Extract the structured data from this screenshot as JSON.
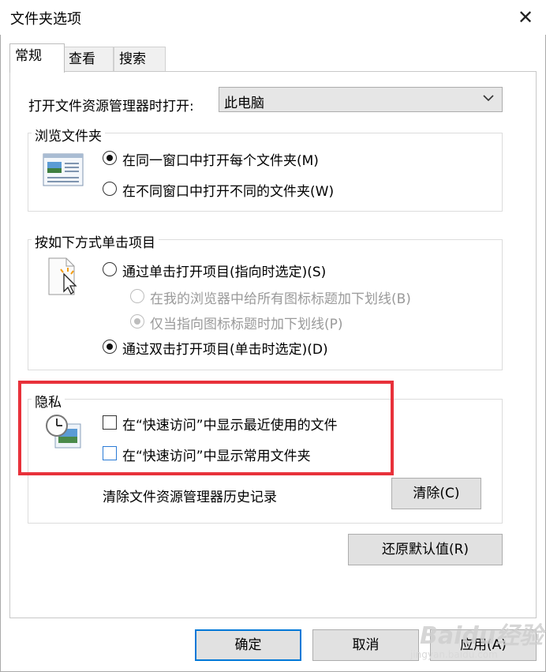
{
  "window": {
    "title": "文件夹选项",
    "close_icon": "close-icon"
  },
  "tabs": [
    {
      "label": "常规",
      "active": true
    },
    {
      "label": "查看",
      "active": false
    },
    {
      "label": "搜索",
      "active": false
    }
  ],
  "open_explorer": {
    "label": "打开文件资源管理器时打开:",
    "value": "此电脑"
  },
  "browse": {
    "legend": "浏览文件夹",
    "options": [
      {
        "label": "在同一窗口中打开每个文件夹(M)",
        "checked": true
      },
      {
        "label": "在不同窗口中打开不同的文件夹(W)",
        "checked": false
      }
    ]
  },
  "click": {
    "legend": "按如下方式单击项目",
    "options": [
      {
        "label": "通过单击打开项目(指向时选定)(S)",
        "checked": false
      },
      {
        "label": "在我的浏览器中给所有图标标题加下划线(B)",
        "checked": false,
        "disabled": true
      },
      {
        "label": "仅当指向图标标题时加下划线(P)",
        "checked": true,
        "disabled": true
      },
      {
        "label": "通过双击打开项目(单击时选定)(D)",
        "checked": true
      }
    ]
  },
  "privacy": {
    "legend": "隐私",
    "options": [
      {
        "label": "在“快速访问”中显示最近使用的文件",
        "checked": false
      },
      {
        "label": "在“快速访问”中显示常用文件夹",
        "checked": false
      }
    ],
    "clear_label": "清除文件资源管理器历史记录",
    "clear_button": "清除(C)"
  },
  "restore_button": "还原默认值(R)",
  "footer": {
    "ok": "确定",
    "cancel": "取消",
    "apply": "应用(A)"
  },
  "watermark": {
    "brand": "Baidu经验",
    "url": "jingyan.baidu.com"
  },
  "colors": {
    "highlight": "#e8313a",
    "focus": "#0078d7"
  }
}
